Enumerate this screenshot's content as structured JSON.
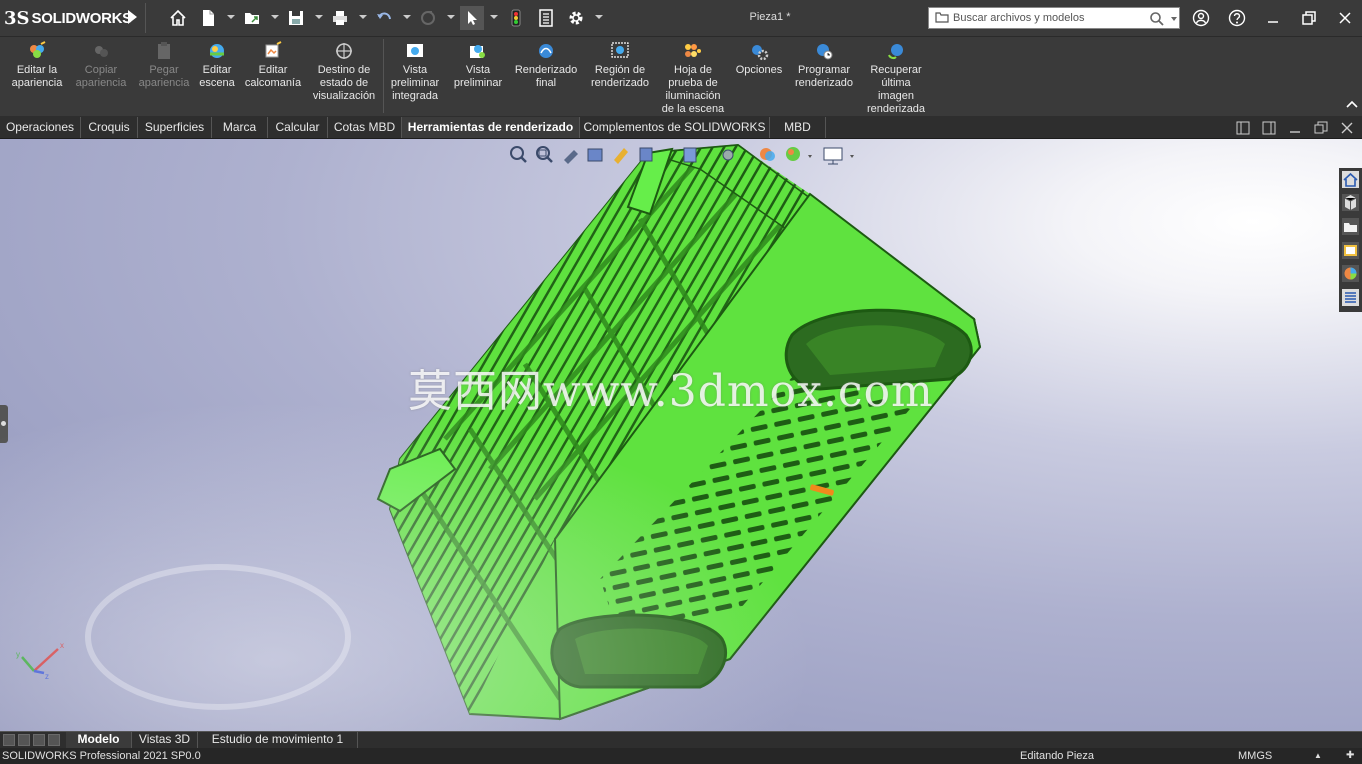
{
  "titlebar": {
    "logo_ds": "3S",
    "logo_text": "SOLIDWORKS",
    "document_title": "Pieza1 *",
    "search_placeholder": "Buscar archivos y modelos"
  },
  "ribbon": {
    "items": [
      {
        "label": "Editar la apariencia",
        "icon": "edit-appearance-icon",
        "enabled": true
      },
      {
        "label": "Copiar apariencia",
        "icon": "copy-appearance-icon",
        "enabled": false
      },
      {
        "label": "Pegar apariencia",
        "icon": "paste-appearance-icon",
        "enabled": false
      },
      {
        "label": "Editar escena",
        "icon": "edit-scene-icon",
        "enabled": true
      },
      {
        "label": "Editar calcomanía",
        "icon": "edit-decal-icon",
        "enabled": true
      },
      {
        "label": "Destino de estado de visualización",
        "icon": "display-state-target-icon",
        "enabled": true
      },
      {
        "label": "Vista preliminar integrada",
        "icon": "integrated-preview-icon",
        "enabled": true
      },
      {
        "label": "Vista preliminar",
        "icon": "preview-window-icon",
        "enabled": true
      },
      {
        "label": "Renderizado final",
        "icon": "final-render-icon",
        "enabled": true
      },
      {
        "label": "Región de renderizado",
        "icon": "render-region-icon",
        "enabled": true
      },
      {
        "label": "Hoja de prueba de iluminación de la escena",
        "icon": "scene-illumination-proof-icon",
        "enabled": true
      },
      {
        "label": "Opciones",
        "icon": "options-icon",
        "enabled": true
      },
      {
        "label": "Programar renderizado",
        "icon": "schedule-render-icon",
        "enabled": true
      },
      {
        "label": "Recuperar última imagen renderizada",
        "icon": "recall-last-render-icon",
        "enabled": true
      }
    ]
  },
  "command_tabs": [
    {
      "label": "Operaciones",
      "active": false
    },
    {
      "label": "Croquis",
      "active": false
    },
    {
      "label": "Superficies",
      "active": false
    },
    {
      "label": "Marca",
      "active": false
    },
    {
      "label": "Calcular",
      "active": false
    },
    {
      "label": "Cotas MBD",
      "active": false
    },
    {
      "label": "Herramientas de renderizado",
      "active": true
    },
    {
      "label": "Complementos de SOLIDWORKS",
      "active": false
    },
    {
      "label": "MBD",
      "active": false
    }
  ],
  "viewport": {
    "watermark": "莫西网www.3dmox.com",
    "model_color": "#66ee4a",
    "model_edge_color": "#1d5a12"
  },
  "bottom_tabs": [
    {
      "label": "Modelo",
      "active": true
    },
    {
      "label": "Vistas 3D",
      "active": false
    },
    {
      "label": "Estudio de movimiento 1",
      "active": false
    }
  ],
  "status_bar": {
    "product": "SOLIDWORKS Professional 2021 SP0.0",
    "mode": "Editando Pieza",
    "units": "MMGS"
  }
}
